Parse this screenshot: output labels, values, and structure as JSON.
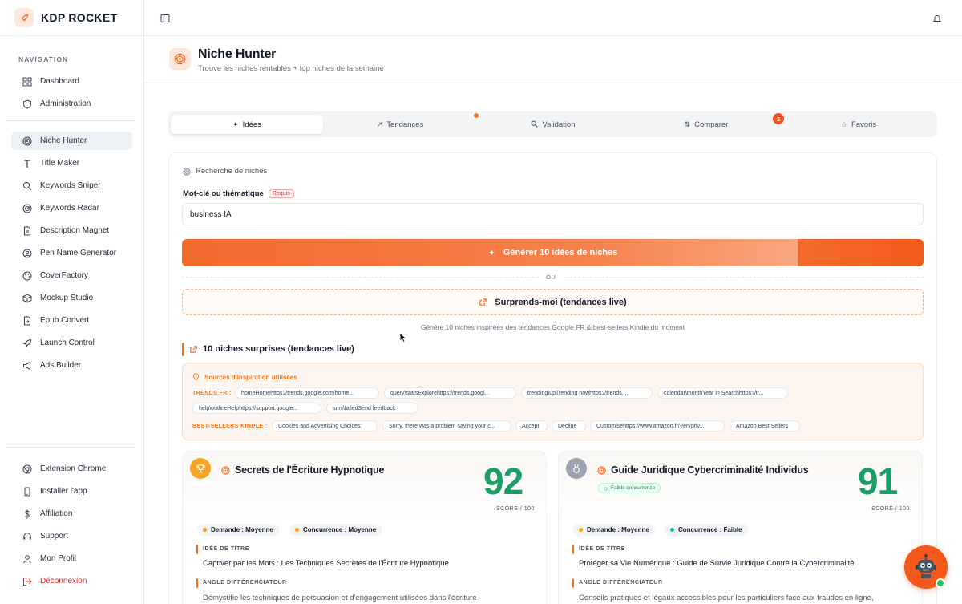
{
  "brand": {
    "name": "KDP ROCKET"
  },
  "sidebar": {
    "heading": "NAVIGATION",
    "items": [
      {
        "label": "Dashboard",
        "icon": "grid-icon"
      },
      {
        "label": "Administration",
        "icon": "shield-icon"
      },
      {
        "label": "Niche Hunter",
        "icon": "target-icon",
        "active": true
      },
      {
        "label": "Title Maker",
        "icon": "text-icon"
      },
      {
        "label": "Keywords Sniper",
        "icon": "search-icon"
      },
      {
        "label": "Keywords Radar",
        "icon": "radar-icon"
      },
      {
        "label": "Description Magnet",
        "icon": "document-icon"
      },
      {
        "label": "Pen Name Generator",
        "icon": "user-circle-icon"
      },
      {
        "label": "CoverFactory",
        "icon": "palette-icon"
      },
      {
        "label": "Mockup Studio",
        "icon": "box-icon"
      },
      {
        "label": "Epub Convert",
        "icon": "file-convert-icon"
      },
      {
        "label": "Launch Control",
        "icon": "rocket-icon"
      },
      {
        "label": "Ads Builder",
        "icon": "megaphone-icon"
      }
    ],
    "bottom_items": [
      {
        "label": "Extension Chrome",
        "icon": "chrome-icon"
      },
      {
        "label": "Installer l'app",
        "icon": "phone-icon"
      },
      {
        "label": "Affiliation",
        "icon": "dollar-icon"
      },
      {
        "label": "Support",
        "icon": "headset-icon"
      },
      {
        "label": "Mon Profil",
        "icon": "user-icon"
      },
      {
        "label": "Déconnexion",
        "icon": "logout-icon"
      }
    ]
  },
  "header": {
    "title": "Niche Hunter",
    "subtitle": "Trouve les niches rentables + top niches de la semaine"
  },
  "tabs": [
    {
      "label": "Idées",
      "icon": "sparkle-icon",
      "active": true
    },
    {
      "label": "Tendances",
      "icon": "trend-icon"
    },
    {
      "label": "Validation",
      "icon": "search-icon"
    },
    {
      "label": "Comparer",
      "icon": "compare-icon"
    },
    {
      "label": "Favoris",
      "icon": "star-icon"
    }
  ],
  "compare_count": "2",
  "search": {
    "section_label": "Recherche de niches",
    "field_label": "Mot-clé ou thématique",
    "required_label": "Requis",
    "value": "business IA",
    "generate_label": "Générer 10 idées de niches",
    "or_label": "OU",
    "surprise_label": "Surprends-moi (tendances live)",
    "hint": "Génère 10 niches inspirées des tendances Google FR & best-sellers Kindle du moment"
  },
  "results": {
    "title": "10 niches surprises (tendances live)",
    "sources": {
      "heading": "Sources d'inspiration utilisées",
      "trends_label": "TRENDS FR :",
      "trends": [
        "homeHomehttps://trends.google.com/home...",
        "query\\statsExplorehttps://trends.googl...",
        "trending\\upTrending nowhttps://trends....",
        "calendar\\monthYear in Searchhttps://tr...",
        "help\\outlineHelphttps://support.google...",
        "sms\\failedSend feedback"
      ],
      "bestsellers_label": "BEST-SELLERS KINDLE :",
      "bestsellers": [
        "Cookies and Advertising Choices",
        "Sorry, there was a problem saving your c...",
        "Accept",
        "Decline",
        "Customisehttps://www.amazon.fr/-/en/priv...",
        "Amazon Best Sellers"
      ]
    },
    "cards": [
      {
        "title": "Secrets de l'Écriture Hypnotique",
        "score": "92",
        "score_label": "SCORE / 100",
        "demand": "Demande : Moyenne",
        "competition": "Concurrence : Moyenne",
        "title_idea_label": "IDÉE DE TITRE",
        "title_idea": "Captiver par les Mots : Les Techniques Secrètes de l'Écriture Hypnotique",
        "angle_label": "ANGLE DIFFÉRENCIATEUR",
        "angle": "Démystifie les techniques de persuasion et d'engagement utilisées dans l'écriture",
        "medal_color": "#f5a524"
      },
      {
        "title": "Guide Juridique Cybercriminalité Individus",
        "badge": "Faible concurrence",
        "score": "91",
        "score_label": "SCORE / 100",
        "demand": "Demande : Moyenne",
        "competition": "Concurrence : Faible",
        "title_idea_label": "IDÉE DE TITRE",
        "title_idea": "Protéger sa Vie Numérique : Guide de Survie Juridique Contre la Cybercriminalité",
        "angle_label": "ANGLE DIFFÉRENCIATEUR",
        "angle": "Conseils pratiques et légaux accessibles pour les particuliers face aux fraudes en ligne,",
        "medal_color": "#9ca3af"
      }
    ]
  },
  "colors": {
    "accent": "#f4692c",
    "score": "#1a9e66",
    "logout": "#dc2626"
  }
}
